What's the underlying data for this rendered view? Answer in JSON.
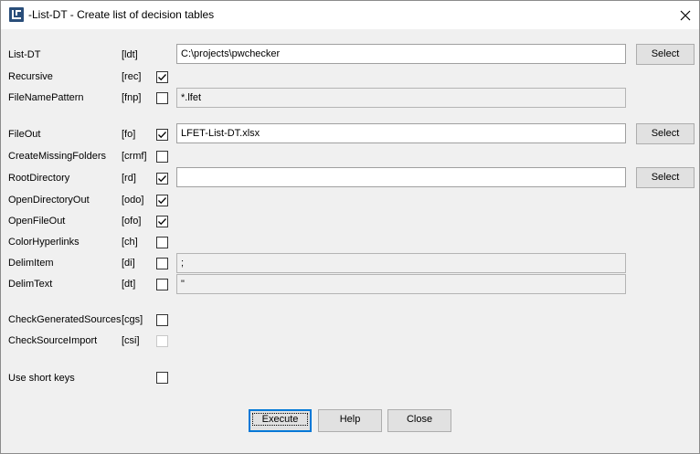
{
  "window": {
    "title": "-List-DT - Create list of decision tables",
    "close_icon": "close-icon"
  },
  "rows": {
    "list_dt": {
      "label": "List-DT",
      "key": "[ldt]",
      "value": "C:\\projects\\pwchecker",
      "button": "Select"
    },
    "recursive": {
      "label": "Recursive",
      "key": "[rec]",
      "checked": true
    },
    "file_name_pattern": {
      "label": "FileNamePattern",
      "key": "[fnp]",
      "checked": false,
      "value": "*.lfet"
    },
    "file_out": {
      "label": "FileOut",
      "key": "[fo]",
      "checked": true,
      "value": "LFET-List-DT.xlsx",
      "button": "Select"
    },
    "create_missing_folders": {
      "label": "CreateMissingFolders",
      "key": "[crmf]",
      "checked": false
    },
    "root_directory": {
      "label": "RootDirectory",
      "key": "[rd]",
      "checked": true,
      "value": "",
      "button": "Select"
    },
    "open_directory_out": {
      "label": "OpenDirectoryOut",
      "key": "[odo]",
      "checked": true
    },
    "open_file_out": {
      "label": "OpenFileOut",
      "key": "[ofo]",
      "checked": true
    },
    "color_hyperlinks": {
      "label": "ColorHyperlinks",
      "key": "[ch]",
      "checked": false
    },
    "delim_item": {
      "label": "DelimItem",
      "key": "[di]",
      "checked": false,
      "value": ";"
    },
    "delim_text": {
      "label": "DelimText",
      "key": "[dt]",
      "checked": false,
      "value": "\""
    },
    "check_generated_sources": {
      "label": "CheckGeneratedSources",
      "key": "[cgs]",
      "checked": false
    },
    "check_source_import": {
      "label": "CheckSourceImport",
      "key": "[csi]",
      "checked": false,
      "disabled": true
    },
    "use_short_keys": {
      "label": "Use short keys",
      "checked": false
    }
  },
  "buttons": {
    "execute": "Execute",
    "help": "Help",
    "close": "Close"
  },
  "colors": {
    "background": "#f0f0f0",
    "titlebar": "#ffffff",
    "default_button_border": "#0078d7",
    "app_icon": "#2a4e7a"
  }
}
